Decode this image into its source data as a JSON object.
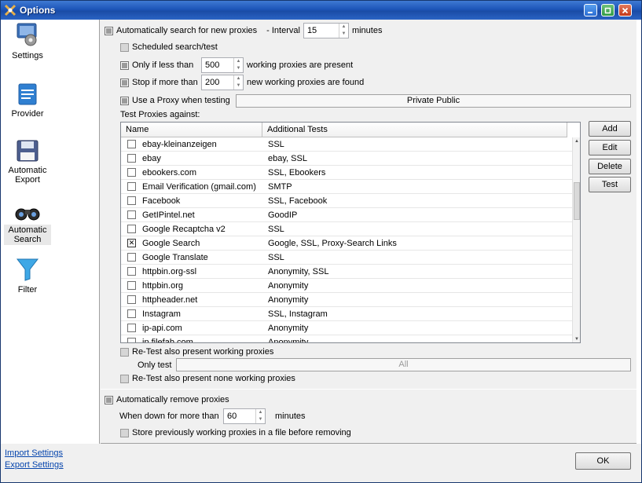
{
  "window": {
    "title": "Options"
  },
  "sidebar": {
    "items": [
      {
        "label": "Settings",
        "icon": "gear-monitor-icon"
      },
      {
        "label": "Provider",
        "icon": "document-list-icon"
      },
      {
        "label": "Automatic Export",
        "icon": "floppy-disk-icon"
      },
      {
        "label": "Automatic Search",
        "icon": "binoculars-icon",
        "selected": true
      },
      {
        "label": "Filter",
        "icon": "funnel-icon"
      }
    ]
  },
  "links": {
    "import": "Import Settings",
    "export": "Export Settings"
  },
  "auto_search": {
    "enabled_label": "Automatically search for new proxies",
    "interval_label": "- Interval",
    "interval_value": "15",
    "interval_unit": "minutes",
    "scheduled_label": "Scheduled search/test",
    "only_if_less_label": "Only if less than",
    "only_if_less_value": "500",
    "only_if_less_suffix": "working proxies are present",
    "stop_if_more_label": "Stop if more than",
    "stop_if_more_value": "200",
    "stop_if_more_suffix": "new working proxies are found",
    "use_proxy_label": "Use a Proxy when testing",
    "proxy_field_value": "Private Public",
    "test_against_label": "Test Proxies against:"
  },
  "grid": {
    "columns": [
      "Name",
      "Additional Tests"
    ],
    "rows": [
      {
        "name": "ebay-kleinanzeigen",
        "tests": "SSL",
        "checked": false
      },
      {
        "name": "ebay",
        "tests": "ebay, SSL",
        "checked": false
      },
      {
        "name": "ebookers.com",
        "tests": "SSL, Ebookers",
        "checked": false
      },
      {
        "name": "Email Verification (gmail.com)",
        "tests": "SMTP",
        "checked": false
      },
      {
        "name": "Facebook",
        "tests": "SSL, Facebook",
        "checked": false
      },
      {
        "name": "GetIPintel.net",
        "tests": "GoodIP",
        "checked": false
      },
      {
        "name": "Google Recaptcha v2",
        "tests": "SSL",
        "checked": false
      },
      {
        "name": "Google Search",
        "tests": "Google, SSL, Proxy-Search Links",
        "checked": true
      },
      {
        "name": "Google Translate",
        "tests": "SSL",
        "checked": false
      },
      {
        "name": "httpbin.org-ssl",
        "tests": "Anonymity, SSL",
        "checked": false
      },
      {
        "name": "httpbin.org",
        "tests": "Anonymity",
        "checked": false
      },
      {
        "name": "httpheader.net",
        "tests": "Anonymity",
        "checked": false
      },
      {
        "name": "Instagram",
        "tests": "SSL, Instagram",
        "checked": false
      },
      {
        "name": "ip-api.com",
        "tests": "Anonymity",
        "checked": false
      },
      {
        "name": "ip.filefab.com",
        "tests": "Anonymity",
        "checked": false
      }
    ]
  },
  "grid_buttons": {
    "add": "Add",
    "edit": "Edit",
    "delete": "Delete",
    "test": "Test"
  },
  "retest": {
    "present_label": "Re-Test also present working proxies",
    "only_test_label": "Only test",
    "only_test_value": "All",
    "none_label": "Re-Test also present none working proxies"
  },
  "auto_remove": {
    "enabled_label": "Automatically remove proxies",
    "down_label": "When down for more than",
    "down_value": "60",
    "down_unit": "minutes",
    "store_label": "Store previously working proxies in a file before removing"
  },
  "footer": {
    "ok": "OK"
  }
}
